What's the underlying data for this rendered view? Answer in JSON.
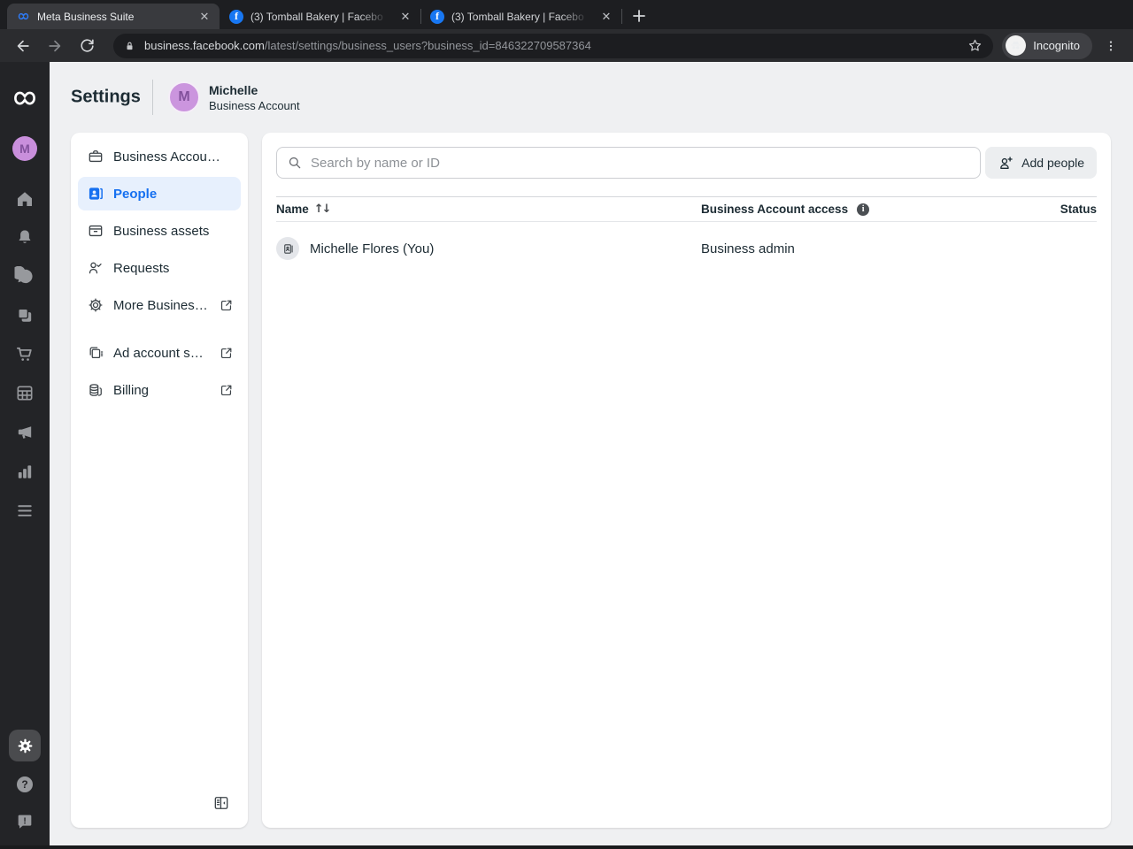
{
  "browser": {
    "tabs": [
      {
        "title": "Meta Business Suite",
        "favicon": "meta-logo-icon",
        "active": true
      },
      {
        "title": "(3) Tomball Bakery | Facebo",
        "favicon": "facebook-icon",
        "active": false
      },
      {
        "title": "(3) Tomball Bakery | Facebo",
        "favicon": "facebook-icon",
        "active": false
      }
    ],
    "url": {
      "domain": "business.facebook.com",
      "path": "/latest/settings/business_users?business_id=846322709587364"
    },
    "incognito_label": "Incognito",
    "fb_favicon_letter": "f"
  },
  "rail": {
    "avatar_letter": "M",
    "icons": [
      "meta-logo-icon",
      "business-avatar",
      "home-icon",
      "notifications-bell-icon",
      "messages-chat-icon",
      "content-posts-icon",
      "commerce-cart-icon",
      "planner-calendar-icon",
      "ads-megaphone-icon",
      "insights-chart-icon",
      "all-tools-menu-icon",
      "settings-gear-icon",
      "help-icon",
      "feedback-icon"
    ]
  },
  "header": {
    "title": "Settings",
    "avatar_letter": "M",
    "account_name": "Michelle",
    "account_type": "Business Account"
  },
  "nav": {
    "items": [
      {
        "label": "Business Accou…",
        "icon": "briefcase-icon",
        "active": false,
        "external": false
      },
      {
        "label": "People",
        "icon": "people-card-icon",
        "active": true,
        "external": false
      },
      {
        "label": "Business assets",
        "icon": "assets-box-icon",
        "active": false,
        "external": false
      },
      {
        "label": "Requests",
        "icon": "person-check-icon",
        "active": false,
        "external": false
      },
      {
        "label": "More Busines…",
        "icon": "gear-outline-icon",
        "active": false,
        "external": true
      },
      {
        "label": "Ad account s…",
        "icon": "ad-account-icon",
        "active": false,
        "external": true
      },
      {
        "label": "Billing",
        "icon": "billing-coins-icon",
        "active": false,
        "external": true
      }
    ]
  },
  "main": {
    "search": {
      "placeholder": "Search by name or ID"
    },
    "add_people_label": "Add people",
    "table": {
      "columns": {
        "name": "Name",
        "access": "Business Account access",
        "status": "Status"
      },
      "sort_glyph": "↑↓",
      "rows": [
        {
          "name": "Michelle Flores (You)",
          "access": "Business admin",
          "status": ""
        }
      ]
    }
  },
  "colors": {
    "accent_blue": "#1670f0",
    "active_nav_bg": "#e7f0fd",
    "avatar_purple": "#cb95de",
    "facebook_blue": "#1877f2"
  }
}
